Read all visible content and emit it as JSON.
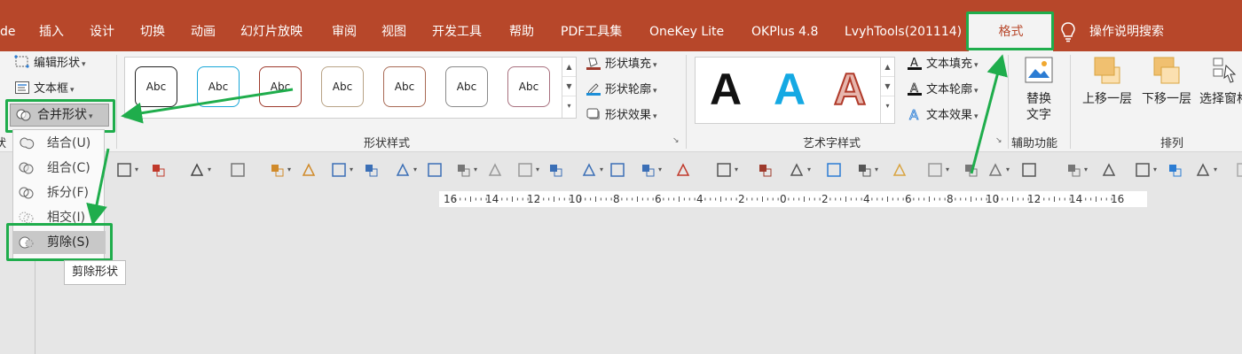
{
  "tabs": [
    {
      "label": "de",
      "name": "tab-design-partial"
    },
    {
      "label": "插入",
      "name": "tab-insert"
    },
    {
      "label": "设计",
      "name": "tab-design"
    },
    {
      "label": "切换",
      "name": "tab-transitions"
    },
    {
      "label": "动画",
      "name": "tab-animations"
    },
    {
      "label": "幻灯片放映",
      "name": "tab-slideshow"
    },
    {
      "label": "审阅",
      "name": "tab-review"
    },
    {
      "label": "视图",
      "name": "tab-view"
    },
    {
      "label": "开发工具",
      "name": "tab-developer"
    },
    {
      "label": "帮助",
      "name": "tab-help"
    },
    {
      "label": "PDF工具集",
      "name": "tab-pdf-tools"
    },
    {
      "label": "OneKey Lite",
      "name": "tab-onekey-lite"
    },
    {
      "label": "OKPlus 4.8",
      "name": "tab-okplus"
    },
    {
      "label": "LvyhTools(201114)",
      "name": "tab-lvyhtools"
    }
  ],
  "active_tab": "格式",
  "tell_me": "操作说明搜索",
  "ribbon": {
    "insert_shapes": {
      "edit_shape": "编辑形状",
      "text_box": "文本框",
      "merge_shapes": "合并形状",
      "partial_label": "状"
    },
    "shape_styles": {
      "label": "形状样式",
      "swatch_text": "Abc",
      "swatches": [
        {
          "border": "#222222"
        },
        {
          "border": "#17a6d8"
        },
        {
          "border": "#9e3a2c"
        },
        {
          "border": "#b8a386"
        },
        {
          "border": "#a86a55"
        },
        {
          "border": "#8a8a8a"
        },
        {
          "border": "#a8707e"
        }
      ],
      "fill": "形状填充",
      "outline": "形状轮廓",
      "effects": "形状效果"
    },
    "wordart": {
      "label": "艺术字样式",
      "letters": [
        "A",
        "A",
        "A"
      ],
      "text_fill": "文本填充",
      "text_outline": "文本轮廓",
      "text_effects": "文本效果"
    },
    "accessibility": {
      "label": "辅助功能",
      "alt_text_line1": "替换",
      "alt_text_line2": "文字"
    },
    "arrange": {
      "label": "排列",
      "bring_forward": "上移一层",
      "send_backward": "下移一层",
      "selection_pane": "选择窗格"
    }
  },
  "merge_menu": {
    "items": [
      {
        "label": "结合(U)",
        "name": "menu-union"
      },
      {
        "label": "组合(C)",
        "name": "menu-combine"
      },
      {
        "label": "拆分(F)",
        "name": "menu-fragment"
      },
      {
        "label": "相交(I)",
        "name": "menu-intersect"
      },
      {
        "label": "剪除(S)",
        "name": "menu-subtract"
      }
    ],
    "tooltip": "剪除形状"
  },
  "ruler": {
    "labels": [
      "16",
      "14",
      "12",
      "10",
      "8",
      "6",
      "4",
      "2",
      "0",
      "2",
      "4",
      "6",
      "8",
      "10",
      "12",
      "14",
      "16"
    ]
  },
  "colors": {
    "title_bar": "#b7472a",
    "ribbon_bg": "#f3f3f3",
    "highlight": "#1fad4c"
  }
}
